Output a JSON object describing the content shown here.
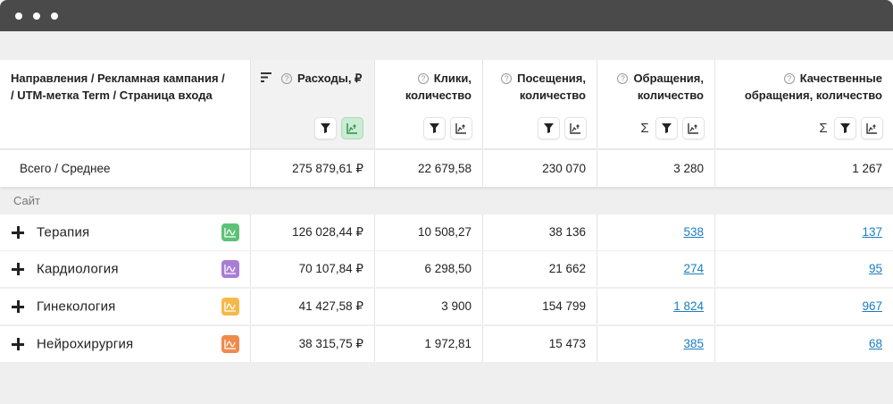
{
  "window": {
    "controls": [
      "close",
      "minimize",
      "maximize"
    ]
  },
  "header": {
    "col0": {
      "line1": "Направления  / Рекламная кампания /",
      "line2": "/ UTM-метка Term / Страница входа"
    },
    "cols": [
      {
        "line1": "Расходы, ₽",
        "line2": ""
      },
      {
        "line1": "Клики,",
        "line2": "количество"
      },
      {
        "line1": "Посещения,",
        "line2": "количество"
      },
      {
        "line1": "Обращения,",
        "line2": "количество"
      },
      {
        "line1": "Качественные",
        "line2": "обращения, количество"
      }
    ],
    "sigma": "Σ",
    "help": "?"
  },
  "totals": {
    "label": "Всего / Среднее",
    "values": [
      "275 879,61 ₽",
      "22 679,58",
      "230 070",
      "3 280",
      "1 267"
    ]
  },
  "group": {
    "label": "Сайт"
  },
  "rows": [
    {
      "name": "Терапия",
      "badge_color": "#5cc277",
      "values": [
        "126 028,44 ₽",
        "10 508,27",
        "38 136",
        "538",
        "137"
      ]
    },
    {
      "name": "Кардиология",
      "badge_color": "#a97dd6",
      "values": [
        "70 107,84 ₽",
        "6 298,50",
        "21 662",
        "274",
        "95"
      ]
    },
    {
      "name": "Гинекология",
      "badge_color": "#f5b94a",
      "values": [
        "41 427,58 ₽",
        "3 900",
        "154 799",
        "1 824",
        "967"
      ]
    },
    {
      "name": "Нейрохирургия",
      "badge_color": "#f08a4b",
      "values": [
        "38 315,75 ₽",
        "1 972,81",
        "15 473",
        "385",
        "68"
      ]
    }
  ],
  "colors": {
    "link": "#1a7ec2",
    "titlebar": "#4a4a4a",
    "active_button": "#c9ecd2"
  },
  "icons": [
    "sort-icon",
    "help-icon",
    "filter-icon",
    "chart-icon",
    "sigma-icon",
    "expand-plus-icon",
    "trend-chart-icon"
  ]
}
